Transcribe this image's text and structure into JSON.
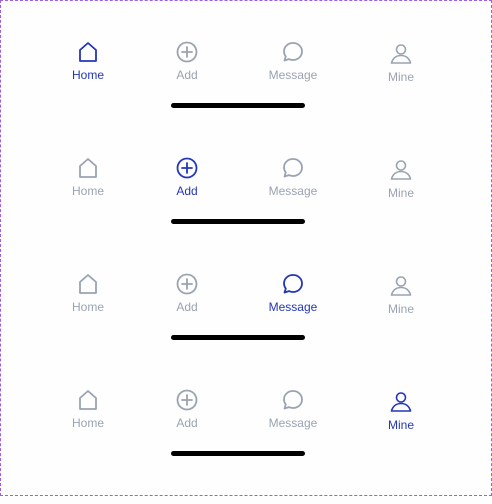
{
  "colors": {
    "active": "#2337b8",
    "inactive": "#9aa3b2",
    "indicator": "#000000"
  },
  "tab_labels": {
    "home": "Home",
    "add": "Add",
    "message": "Message",
    "mine": "Mine"
  },
  "icons": {
    "home": "home-icon",
    "add": "plus-circle-icon",
    "message": "message-bubble-icon",
    "mine": "user-icon"
  },
  "tab_bars": [
    {
      "active_tab": "Home"
    },
    {
      "active_tab": "Add"
    },
    {
      "active_tab": "Message"
    },
    {
      "active_tab": "Mine"
    }
  ]
}
